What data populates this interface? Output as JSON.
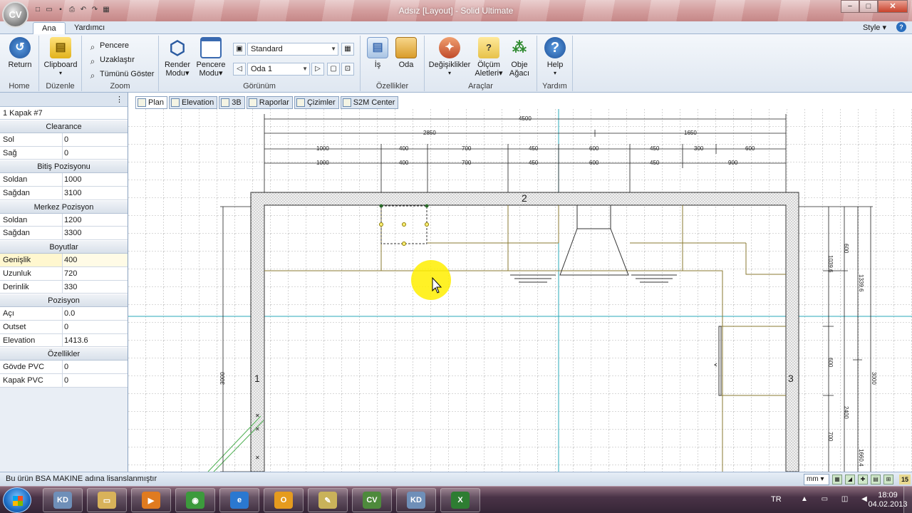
{
  "window": {
    "app_logo": "CV",
    "title": "Adsız [Layout] - Solid Ultimate",
    "buttons": {
      "minimize": "−",
      "maximize": "□",
      "close": "✕"
    }
  },
  "quick_access": [
    {
      "name": "new-file-icon",
      "glyph": "□"
    },
    {
      "name": "open-folder-icon",
      "glyph": "▭"
    },
    {
      "name": "save-icon",
      "glyph": "▪"
    },
    {
      "name": "print-icon",
      "glyph": "⎙"
    },
    {
      "name": "undo-icon",
      "glyph": "↶"
    },
    {
      "name": "redo-icon",
      "glyph": "↷"
    },
    {
      "name": "settings-icon",
      "glyph": "▦"
    }
  ],
  "ribbon_tabs": [
    {
      "label": "Ana",
      "active": true
    },
    {
      "label": "Yardımcı",
      "active": false
    }
  ],
  "style_menu": "Style",
  "ribbon": {
    "home": {
      "return_label": "Return",
      "group": "Home"
    },
    "duzenle": {
      "clipboard_label": "Clipboard",
      "group": "Düzenle"
    },
    "zoom": {
      "window": "Pencere",
      "zoom_out": "Uzaklaştır",
      "show_all": "Tümünü Göster",
      "group": "Zoom"
    },
    "gorunum": {
      "render_label_1": "Render",
      "render_label_2": "Modu",
      "window_label_1": "Pencere",
      "window_label_2": "Modu",
      "view_combo": "Standard",
      "room_combo": "Oda 1",
      "group": "Görünüm"
    },
    "ozellikler": {
      "job_label": "İş",
      "room_label": "Oda",
      "group": "Özellikler"
    },
    "araclar": {
      "changes_label": "Değişiklikler",
      "measure_label_1": "Ölçüm",
      "measure_label_2": "Aletleri",
      "tree_label_1": "Obje",
      "tree_label_2": "Ağacı",
      "group": "Araçlar"
    },
    "yardim": {
      "help_label": "Help",
      "group": "Yardım"
    }
  },
  "panel": {
    "pin": "⋮",
    "object_name": "1 Kapak #7",
    "sections": [
      {
        "title": "Clearance",
        "rows": [
          {
            "k": "Sol",
            "v": "0"
          },
          {
            "k": "Sağ",
            "v": "0"
          }
        ]
      },
      {
        "title": "Bitiş Pozisyonu",
        "rows": [
          {
            "k": "Soldan",
            "v": "1000"
          },
          {
            "k": "Sağdan",
            "v": "3100"
          }
        ]
      },
      {
        "title": "Merkez Pozisyon",
        "rows": [
          {
            "k": "Soldan",
            "v": "1200"
          },
          {
            "k": "Sağdan",
            "v": "3300"
          }
        ]
      },
      {
        "title": "Boyutlar",
        "rows": [
          {
            "k": "Genişlik",
            "v": "400"
          },
          {
            "k": "Uzunluk",
            "v": "720"
          },
          {
            "k": "Derinlik",
            "v": "330"
          }
        ]
      },
      {
        "title": "Pozisyon",
        "rows": [
          {
            "k": "Açı",
            "v": "0.0"
          },
          {
            "k": "Outset",
            "v": "0"
          },
          {
            "k": "Elevation",
            "v": "1413.6"
          }
        ]
      },
      {
        "title": "Özellikler",
        "rows": [
          {
            "k": "Gövde PVC",
            "v": "0"
          },
          {
            "k": "Kapak PVC",
            "v": "0"
          }
        ]
      }
    ]
  },
  "view_tabs": [
    {
      "label": "Plan",
      "active": true
    },
    {
      "label": "Elevation",
      "active": false
    },
    {
      "label": "3B",
      "active": false
    },
    {
      "label": "Raporlar",
      "active": false
    },
    {
      "label": "Çizimler",
      "active": false
    },
    {
      "label": "S2M Center",
      "active": false
    }
  ],
  "drawing": {
    "wall_labels": [
      "1",
      "2",
      "3"
    ],
    "top_dims_total": "4500",
    "top_dims_split": [
      "2850",
      "1650"
    ],
    "top_dims_row1": [
      "1000",
      "400",
      "700",
      "450",
      "600",
      "450",
      "300",
      "600"
    ],
    "top_dims_row2": [
      "1000",
      "400",
      "700",
      "450",
      "600",
      "450",
      "900"
    ],
    "left_dim": "3000",
    "right_dims": [
      "600",
      "1039.6",
      "1339.6",
      "600",
      "2400",
      "700",
      "3000",
      "1660.4"
    ]
  },
  "status": {
    "license": "Bu ürün BSA MAKINE adına lisanslanmıştır",
    "unit": "mm",
    "snap": "15"
  },
  "taskbar": {
    "apps": [
      {
        "name": "kd-app",
        "label": "KD",
        "color": "#6f8fb8"
      },
      {
        "name": "file-explorer",
        "label": "▭",
        "color": "#d8b25a"
      },
      {
        "name": "media-player",
        "label": "▶",
        "color": "#e07b20"
      },
      {
        "name": "chrome",
        "label": "◉",
        "color": "#3c9a3c"
      },
      {
        "name": "internet-explorer",
        "label": "e",
        "color": "#2a78d0"
      },
      {
        "name": "outlook",
        "label": "O",
        "color": "#e59b1e"
      },
      {
        "name": "notes",
        "label": "✎",
        "color": "#c9b25a"
      },
      {
        "name": "cv-app",
        "label": "CV",
        "color": "#4e8a3c"
      },
      {
        "name": "kd-app-2",
        "label": "KD",
        "color": "#6f8fb8"
      },
      {
        "name": "excel",
        "label": "X",
        "color": "#2e7d32"
      }
    ],
    "language": "TR",
    "time": "18:09",
    "date": "04.02.2013"
  }
}
